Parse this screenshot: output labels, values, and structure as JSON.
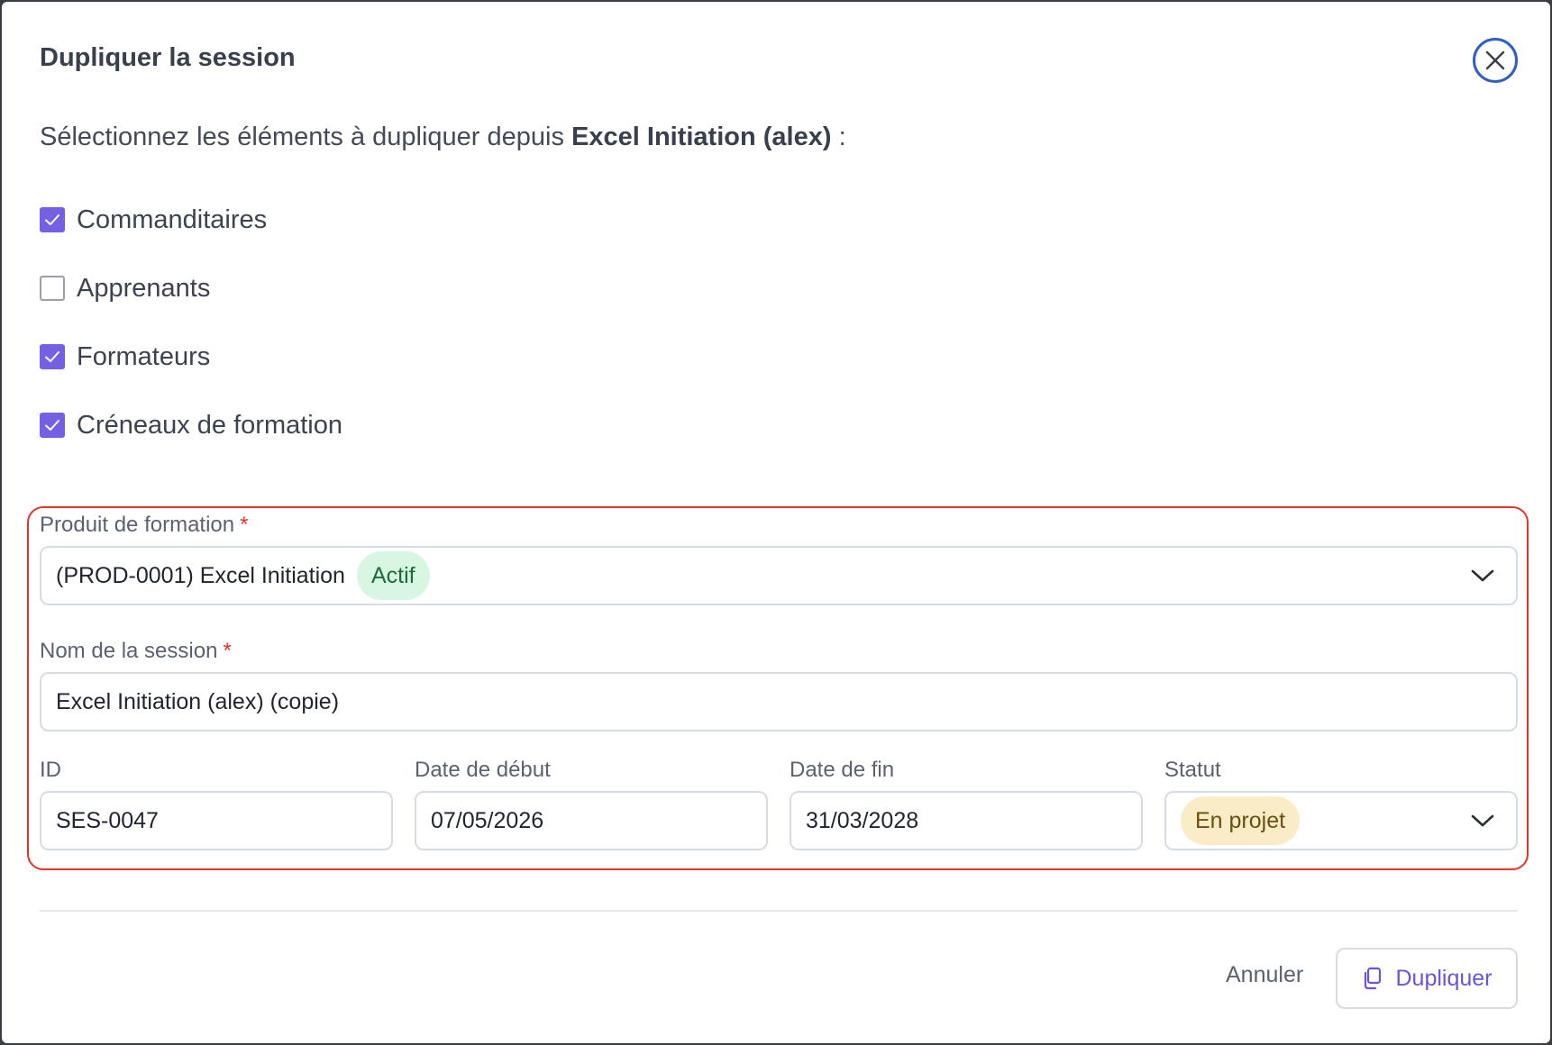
{
  "dialog": {
    "title": "Dupliquer la session",
    "intro_prefix": "Sélectionnez les éléments à dupliquer depuis ",
    "intro_source": "Excel Initiation (alex)",
    "intro_suffix": " :"
  },
  "options": [
    {
      "label": "Commanditaires",
      "checked": true
    },
    {
      "label": "Apprenants",
      "checked": false
    },
    {
      "label": "Formateurs",
      "checked": true
    },
    {
      "label": "Créneaux de formation",
      "checked": true
    }
  ],
  "form": {
    "product": {
      "label": "Produit de formation",
      "required_mark": "*",
      "value": "(PROD-0001) Excel Initiation",
      "badge": "Actif"
    },
    "session_name": {
      "label": "Nom de la session",
      "required_mark": "*",
      "value": "Excel Initiation (alex) (copie)"
    },
    "id": {
      "label": "ID",
      "value": "SES-0047"
    },
    "start_date": {
      "label": "Date de début",
      "value": "07/05/2026"
    },
    "end_date": {
      "label": "Date de fin",
      "value": "31/03/2028"
    },
    "status": {
      "label": "Statut",
      "value": "En projet"
    }
  },
  "footer": {
    "cancel_label": "Annuler",
    "duplicate_label": "Dupliquer"
  },
  "colors": {
    "accent": "#7560e3",
    "required": "#e2342b",
    "close_ring": "#2f5fc4",
    "badge_active_bg": "#d7f7e3",
    "badge_status_bg": "#faecc7"
  }
}
